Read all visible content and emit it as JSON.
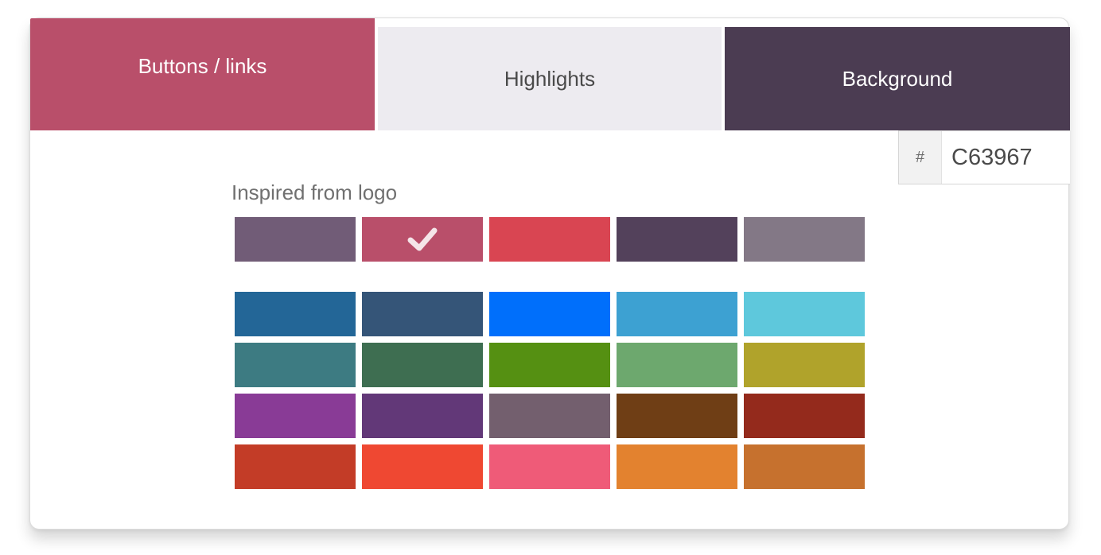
{
  "tabs": {
    "buttons_label": "Buttons / links",
    "highlights_label": "Highlights",
    "background_label": "Background",
    "buttons_color": "#B94F6A",
    "highlights_color": "#EDEBF0",
    "background_color": "#4B3C52"
  },
  "hex": {
    "prefix": "#",
    "value": "C63967"
  },
  "logo_section": {
    "label": "Inspired from logo",
    "swatches": [
      {
        "color": "#715C77",
        "selected": false
      },
      {
        "color": "#B94F6A",
        "selected": true,
        "icon": "check-icon"
      },
      {
        "color": "#D94552",
        "selected": false
      },
      {
        "color": "#53415B",
        "selected": false
      },
      {
        "color": "#837886",
        "selected": false
      }
    ]
  },
  "preset_section": {
    "swatches": [
      "#236697",
      "#355578",
      "#006FFB",
      "#3DA1D2",
      "#5EC8DC",
      "#3D7B82",
      "#3E6E51",
      "#559012",
      "#6DA86E",
      "#B0A32B",
      "#893B96",
      "#623878",
      "#735F6E",
      "#6F3E15",
      "#942A1C",
      "#C33C27",
      "#EF4832",
      "#EF5B78",
      "#E3822F",
      "#C6712E"
    ]
  }
}
